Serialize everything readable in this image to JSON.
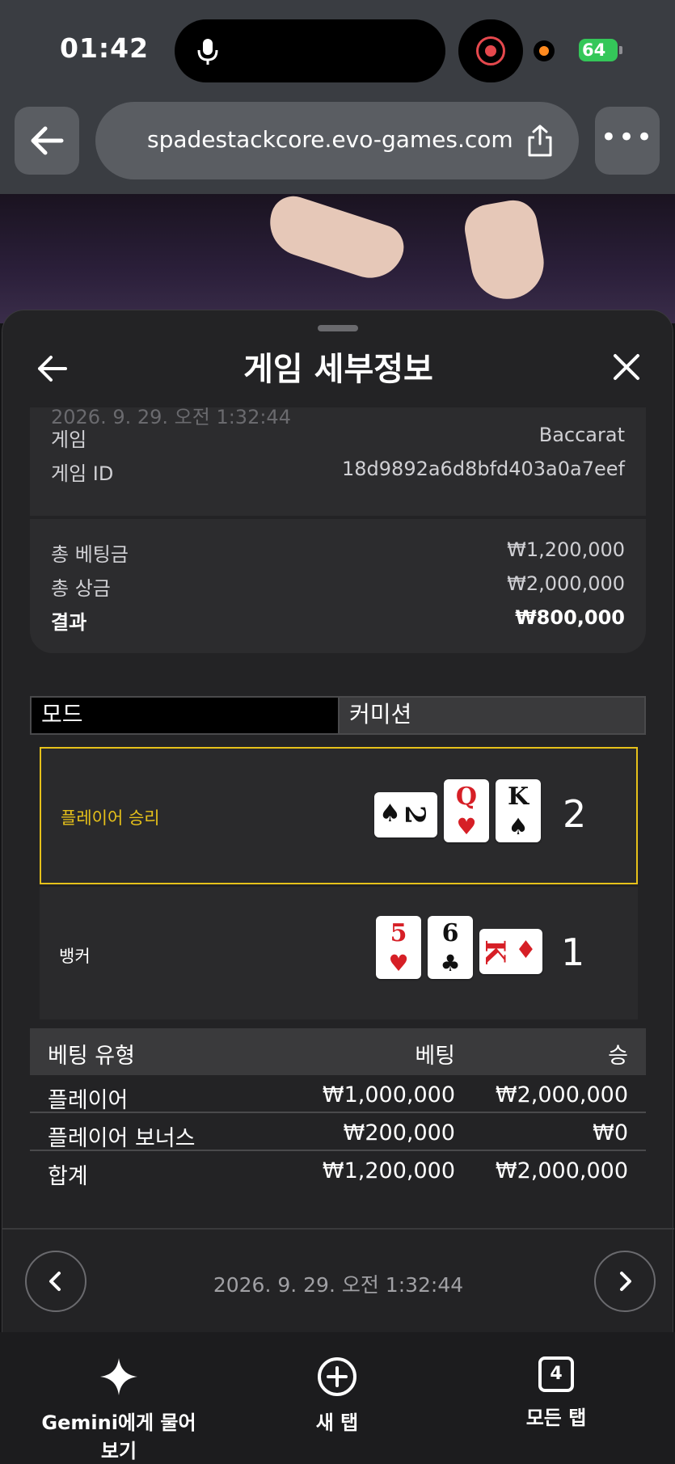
{
  "status_bar": {
    "time": "01:42",
    "battery": "64"
  },
  "browser": {
    "url": "spadestackcore.evo-games.com",
    "more": "•••"
  },
  "sheet": {
    "title": "게임 세부정보",
    "faded_date": "2026. 9. 29. 오전 1:32:44",
    "info": [
      {
        "label": "게임",
        "value": "Baccarat"
      },
      {
        "label": "게임 ID",
        "value": "18d9892a6d8bfd403a0a7eef"
      }
    ],
    "totals": [
      {
        "label": "총 베팅금",
        "value": "₩1,200,000"
      },
      {
        "label": "총 상금",
        "value": "₩2,000,000"
      },
      {
        "label": "결과",
        "value": "₩800,000"
      }
    ],
    "mode": {
      "label": "모드",
      "value": "커미션"
    },
    "results": [
      {
        "label": "플레이어 승리",
        "label_color": "#e6c11a",
        "score": "2",
        "cards": [
          {
            "rank": "2",
            "suit": "♠",
            "color": "black"
          },
          {
            "rank": "Q",
            "suit": "♥",
            "color": "red"
          },
          {
            "rank": "K",
            "suit": "♠",
            "color": "black"
          }
        ]
      },
      {
        "label": "뱅커",
        "label_color": "#ffffff",
        "score": "1",
        "cards": [
          {
            "rank": "5",
            "suit": "♥",
            "color": "red"
          },
          {
            "rank": "6",
            "suit": "♣",
            "color": "black"
          },
          {
            "rank": "K",
            "suit": "♦",
            "color": "red"
          }
        ]
      }
    ],
    "bet_table": {
      "headers": [
        "베팅 유형",
        "베팅",
        "승"
      ],
      "rows": [
        [
          "플레이어",
          "₩1,000,000",
          "₩2,000,000"
        ],
        [
          "플레이어 보너스",
          "₩200,000",
          "₩0"
        ],
        [
          "합계",
          "₩1,200,000",
          "₩2,000,000"
        ]
      ]
    },
    "nav_date": "2026. 9. 29. 오전 1:32:44"
  },
  "toolbar": {
    "ask_gemini": "Gemini에게 물어보기",
    "new_tab": "새 탭",
    "all_tabs": "모든 탭",
    "tab_count": "4"
  },
  "colors": {
    "accent": "#e6c11a",
    "red_suit": "#d61f26",
    "battery": "#34c759"
  }
}
